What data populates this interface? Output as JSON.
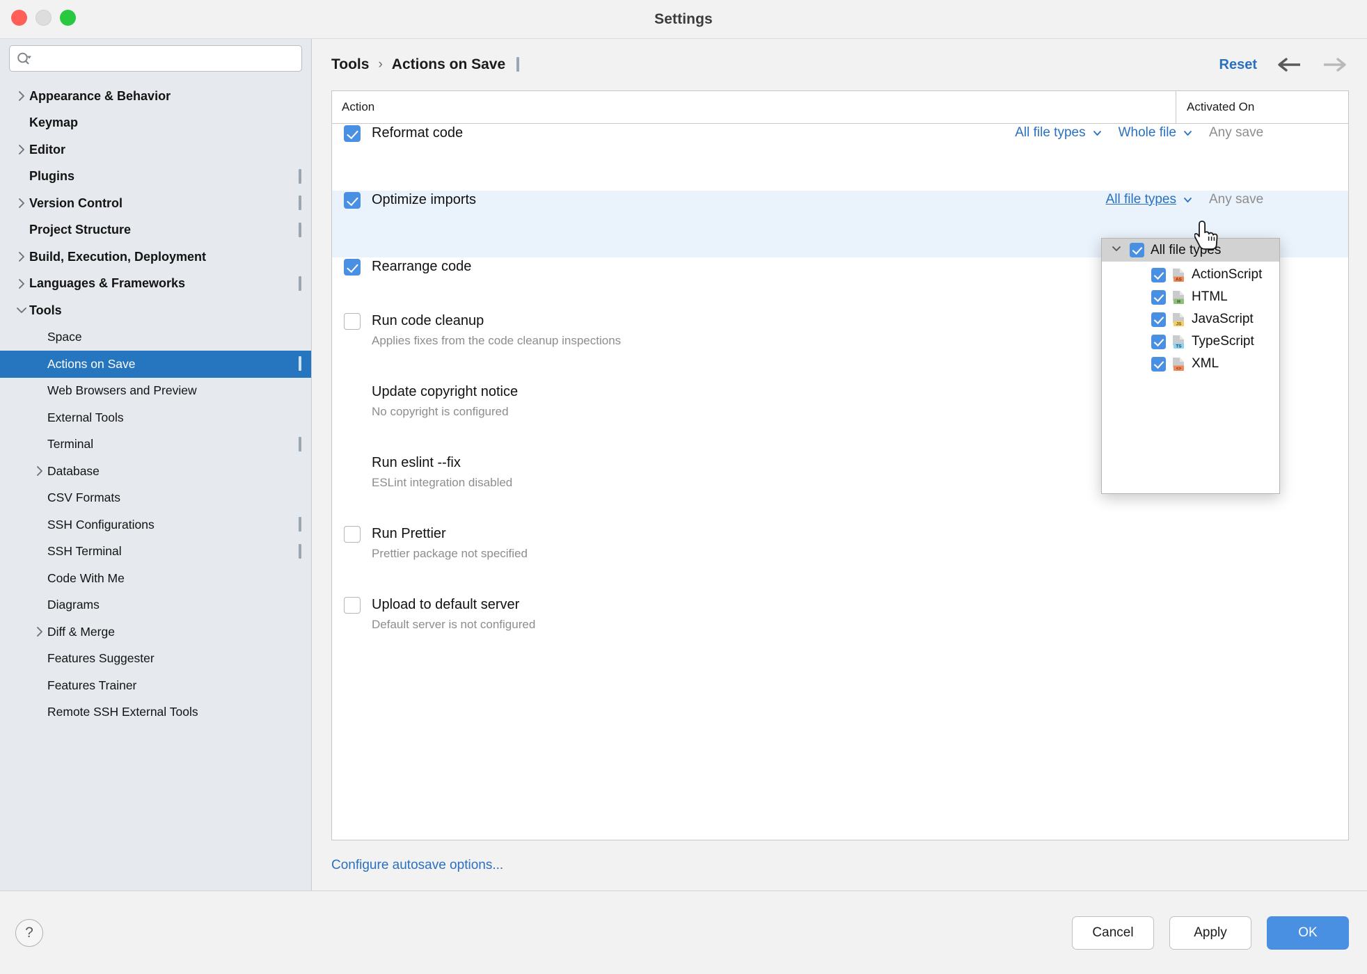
{
  "window": {
    "title": "Settings",
    "traffic_lights": [
      "close",
      "minimize",
      "zoom"
    ]
  },
  "sidebar": {
    "search": {
      "value": "",
      "placeholder": ""
    },
    "items": [
      {
        "label": "Appearance & Behavior",
        "level": 1,
        "bold": true,
        "arrow": "right",
        "config_icon": false,
        "selected": false
      },
      {
        "label": "Keymap",
        "level": 1,
        "bold": true,
        "arrow": "none",
        "config_icon": false,
        "selected": false
      },
      {
        "label": "Editor",
        "level": 1,
        "bold": true,
        "arrow": "right",
        "config_icon": false,
        "selected": false
      },
      {
        "label": "Plugins",
        "level": 1,
        "bold": true,
        "arrow": "none",
        "config_icon": true,
        "selected": false
      },
      {
        "label": "Version Control",
        "level": 1,
        "bold": true,
        "arrow": "right",
        "config_icon": true,
        "selected": false
      },
      {
        "label": "Project Structure",
        "level": 1,
        "bold": true,
        "arrow": "none",
        "config_icon": true,
        "selected": false
      },
      {
        "label": "Build, Execution, Deployment",
        "level": 1,
        "bold": true,
        "arrow": "right",
        "config_icon": false,
        "selected": false
      },
      {
        "label": "Languages & Frameworks",
        "level": 1,
        "bold": true,
        "arrow": "right",
        "config_icon": true,
        "selected": false
      },
      {
        "label": "Tools",
        "level": 1,
        "bold": true,
        "arrow": "down",
        "config_icon": false,
        "selected": false
      },
      {
        "label": "Space",
        "level": 2,
        "bold": false,
        "arrow": "none",
        "config_icon": false,
        "selected": false
      },
      {
        "label": "Actions on Save",
        "level": 2,
        "bold": false,
        "arrow": "none",
        "config_icon": true,
        "selected": true
      },
      {
        "label": "Web Browsers and Preview",
        "level": 2,
        "bold": false,
        "arrow": "none",
        "config_icon": false,
        "selected": false
      },
      {
        "label": "External Tools",
        "level": 2,
        "bold": false,
        "arrow": "none",
        "config_icon": false,
        "selected": false
      },
      {
        "label": "Terminal",
        "level": 2,
        "bold": false,
        "arrow": "none",
        "config_icon": true,
        "selected": false
      },
      {
        "label": "Database",
        "level": 2,
        "bold": false,
        "arrow": "right",
        "config_icon": false,
        "selected": false
      },
      {
        "label": "CSV Formats",
        "level": 2,
        "bold": false,
        "arrow": "none",
        "config_icon": false,
        "selected": false
      },
      {
        "label": "SSH Configurations",
        "level": 2,
        "bold": false,
        "arrow": "none",
        "config_icon": true,
        "selected": false
      },
      {
        "label": "SSH Terminal",
        "level": 2,
        "bold": false,
        "arrow": "none",
        "config_icon": true,
        "selected": false
      },
      {
        "label": "Code With Me",
        "level": 2,
        "bold": false,
        "arrow": "none",
        "config_icon": false,
        "selected": false
      },
      {
        "label": "Diagrams",
        "level": 2,
        "bold": false,
        "arrow": "none",
        "config_icon": false,
        "selected": false
      },
      {
        "label": "Diff & Merge",
        "level": 2,
        "bold": false,
        "arrow": "right",
        "config_icon": false,
        "selected": false
      },
      {
        "label": "Features Suggester",
        "level": 2,
        "bold": false,
        "arrow": "none",
        "config_icon": false,
        "selected": false
      },
      {
        "label": "Features Trainer",
        "level": 2,
        "bold": false,
        "arrow": "none",
        "config_icon": false,
        "selected": false
      },
      {
        "label": "Remote SSH External Tools",
        "level": 2,
        "bold": false,
        "arrow": "none",
        "config_icon": false,
        "selected": false
      }
    ]
  },
  "header": {
    "breadcrumb": [
      "Tools",
      "Actions on Save"
    ],
    "separator": "›",
    "reset_label": "Reset",
    "back_arrow": "←",
    "forward_arrow": "→"
  },
  "table": {
    "columns": {
      "action": "Action",
      "activated_on": "Activated On"
    },
    "rows": [
      {
        "title": "Reformat code",
        "subtitle": "",
        "checkbox": "checked",
        "highlighted": false,
        "options": [
          {
            "label": "All file types",
            "type": "dropdown",
            "active": false
          },
          {
            "label": "Whole file",
            "type": "dropdown",
            "active": false
          }
        ],
        "activated_on": "Any save"
      },
      {
        "title": "Optimize imports",
        "subtitle": "",
        "checkbox": "checked",
        "highlighted": true,
        "options": [
          {
            "label": "All file types",
            "type": "dropdown",
            "active": true
          }
        ],
        "activated_on": "Any save"
      },
      {
        "title": "Rearrange code",
        "subtitle": "",
        "checkbox": "checked",
        "highlighted": false,
        "options": [],
        "activated_on": ""
      },
      {
        "title": "Run code cleanup",
        "subtitle": "Applies fixes from the code cleanup inspections",
        "checkbox": "unchecked",
        "highlighted": false,
        "options": [],
        "activated_on": ""
      },
      {
        "title": "Update copyright notice",
        "subtitle": "No copyright is configured",
        "checkbox": "none",
        "highlighted": false,
        "options": [],
        "activated_on": ""
      },
      {
        "title": "Run eslint --fix",
        "subtitle": "ESLint integration disabled",
        "checkbox": "none",
        "highlighted": false,
        "options": [],
        "activated_on": ""
      },
      {
        "title": "Run Prettier",
        "subtitle": "Prettier package not specified",
        "checkbox": "unchecked",
        "highlighted": false,
        "options": [],
        "activated_on": ""
      },
      {
        "title": "Upload to default server",
        "subtitle": "Default server is not configured",
        "checkbox": "unchecked",
        "highlighted": false,
        "options": [],
        "activated_on": ""
      }
    ],
    "autosave_link": "Configure autosave options..."
  },
  "dropdown": {
    "header": {
      "label": "All file types",
      "checked": true,
      "expanded": true
    },
    "items": [
      {
        "label": "ActionScript",
        "checked": true,
        "icon": "file-actionscript-icon",
        "badge": "AS",
        "badge_bg": "#f0885a",
        "badge_fg": "#7a3a15"
      },
      {
        "label": "HTML",
        "checked": true,
        "icon": "file-html-icon",
        "badge": "H",
        "badge_bg": "#8ec07c",
        "badge_fg": "#2d4a22"
      },
      {
        "label": "JavaScript",
        "checked": true,
        "icon": "file-javascript-icon",
        "badge": "JS",
        "badge_bg": "#f5ce6b",
        "badge_fg": "#6e5611"
      },
      {
        "label": "TypeScript",
        "checked": true,
        "icon": "file-typescript-icon",
        "badge": "TS",
        "badge_bg": "#8ed4f0",
        "badge_fg": "#17485c"
      },
      {
        "label": "XML",
        "checked": true,
        "icon": "file-xml-icon",
        "badge": "<>",
        "badge_bg": "#f0885a",
        "badge_fg": "#7a3a15"
      }
    ]
  },
  "footer": {
    "help_label": "?",
    "cancel_label": "Cancel",
    "apply_label": "Apply",
    "ok_label": "OK"
  },
  "colors": {
    "accent": "#2675bf",
    "link": "#2a70c0",
    "checkbox": "#4a90e2",
    "sidebar_bg": "#e6eaee",
    "row_highlight": "#eaf2fb"
  }
}
